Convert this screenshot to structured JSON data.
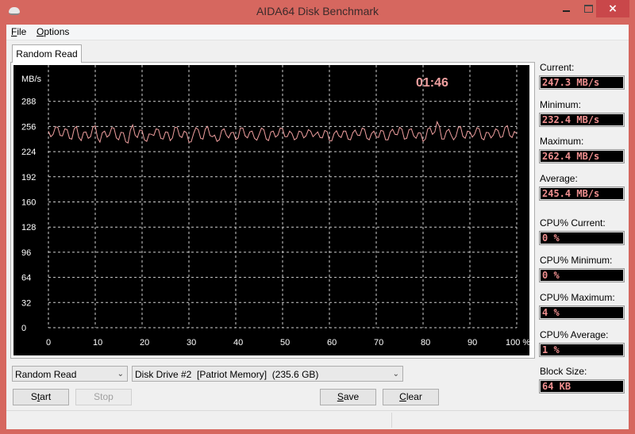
{
  "window": {
    "title": "AIDA64 Disk Benchmark",
    "icon": "disk-icon",
    "controls": {
      "minimize": "minimize-icon",
      "maximize": "maximize-icon",
      "close": "×"
    }
  },
  "menu": {
    "items": [
      {
        "label": "File",
        "accel": "F",
        "rest": "ile"
      },
      {
        "label": "Options",
        "accel": "O",
        "rest": "ptions"
      }
    ]
  },
  "tabs": [
    {
      "label": "Random Read",
      "active": true
    }
  ],
  "colors": {
    "line": "#f0a0a0",
    "grid": "#cfcfcf",
    "timer": "#f0a0a0",
    "value_text": "#ef8f8f",
    "titlebar": "#d6675f"
  },
  "chart_data": {
    "type": "line",
    "title": "",
    "timer": "01:46",
    "ylabel": "MB/s",
    "xlabel": "%",
    "ylim": [
      0,
      320
    ],
    "xlim": [
      0,
      100
    ],
    "y_ticks": [
      "288",
      "256",
      "224",
      "192",
      "160",
      "128",
      "96",
      "64",
      "32",
      "0"
    ],
    "y_tick_values": [
      288,
      256,
      224,
      192,
      160,
      128,
      96,
      64,
      32,
      0
    ],
    "x_ticks": [
      "0",
      "10",
      "20",
      "30",
      "40",
      "50",
      "60",
      "70",
      "80",
      "90",
      "100 %"
    ],
    "x_tick_values": [
      0,
      10,
      20,
      30,
      40,
      50,
      60,
      70,
      80,
      90,
      100
    ],
    "grid": true,
    "series": [
      {
        "name": "Random Read",
        "x": [
          0,
          1,
          2,
          3,
          4,
          5,
          6,
          7,
          8,
          9,
          10,
          11,
          12,
          13,
          14,
          15,
          16,
          17,
          18,
          19,
          20,
          21,
          22,
          23,
          24,
          25,
          26,
          27,
          28,
          29,
          30,
          31,
          32,
          33,
          34,
          35,
          36,
          37,
          38,
          39,
          40,
          41,
          42,
          43,
          44,
          45,
          46,
          47,
          48,
          49,
          50,
          51,
          52,
          53,
          54,
          55,
          56,
          57,
          58,
          59,
          60,
          61,
          62,
          63,
          64,
          65,
          66,
          67,
          68,
          69,
          70,
          71,
          72,
          73,
          74,
          75,
          76,
          77,
          78,
          79,
          80,
          81,
          82,
          83,
          84,
          85,
          86,
          87,
          88,
          89,
          90,
          91,
          92,
          93,
          94,
          95,
          96,
          97,
          98,
          99,
          100
        ],
        "values": [
          250,
          246,
          255,
          244,
          252,
          240,
          256,
          238,
          249,
          243,
          257,
          236,
          250,
          245,
          254,
          239,
          248,
          235,
          258,
          242,
          251,
          237,
          246,
          253,
          241,
          249,
          238,
          255,
          244,
          250,
          236,
          247,
          252,
          240,
          256,
          243,
          237,
          251,
          245,
          248,
          239,
          254,
          244,
          249,
          241,
          246,
          252,
          238,
          250,
          245,
          253,
          243,
          247,
          241,
          249,
          244,
          250,
          246,
          242,
          251,
          238,
          247,
          244,
          250,
          240,
          248,
          245,
          254,
          241,
          247,
          243,
          251,
          239,
          249,
          246,
          255,
          240,
          252,
          244,
          248,
          237,
          253,
          246,
          262,
          240,
          250,
          245,
          243,
          256,
          241,
          249,
          246,
          253,
          239,
          248,
          245,
          251,
          243,
          257,
          242,
          247
        ]
      }
    ]
  },
  "stats": {
    "current": {
      "label": "Current:",
      "value": "247.3 MB/s"
    },
    "minimum": {
      "label": "Minimum:",
      "value": "232.4 MB/s"
    },
    "maximum": {
      "label": "Maximum:",
      "value": "262.4 MB/s"
    },
    "average": {
      "label": "Average:",
      "value": "245.4 MB/s"
    },
    "cpu_current": {
      "label": "CPU% Current:",
      "value": "0 %"
    },
    "cpu_minimum": {
      "label": "CPU% Minimum:",
      "value": "0 %"
    },
    "cpu_maximum": {
      "label": "CPU% Maximum:",
      "value": "4 %"
    },
    "cpu_average": {
      "label": "CPU% Average:",
      "value": "1 %"
    },
    "block_size": {
      "label": "Block Size:",
      "value": "64 KB"
    }
  },
  "controls": {
    "test_select": {
      "value": "Random Read"
    },
    "drive_select": {
      "value": "Disk Drive #2  [Patriot Memory]  (235.6 GB)"
    },
    "start": {
      "accel_pre": "S",
      "accel": "t",
      "rest": "art",
      "label": "Start"
    },
    "stop": {
      "label": "Stop",
      "disabled": true
    },
    "save": {
      "accel": "S",
      "rest": "ave",
      "label": "Save"
    },
    "clear": {
      "accel": "C",
      "rest": "lear",
      "label": "Clear"
    }
  }
}
